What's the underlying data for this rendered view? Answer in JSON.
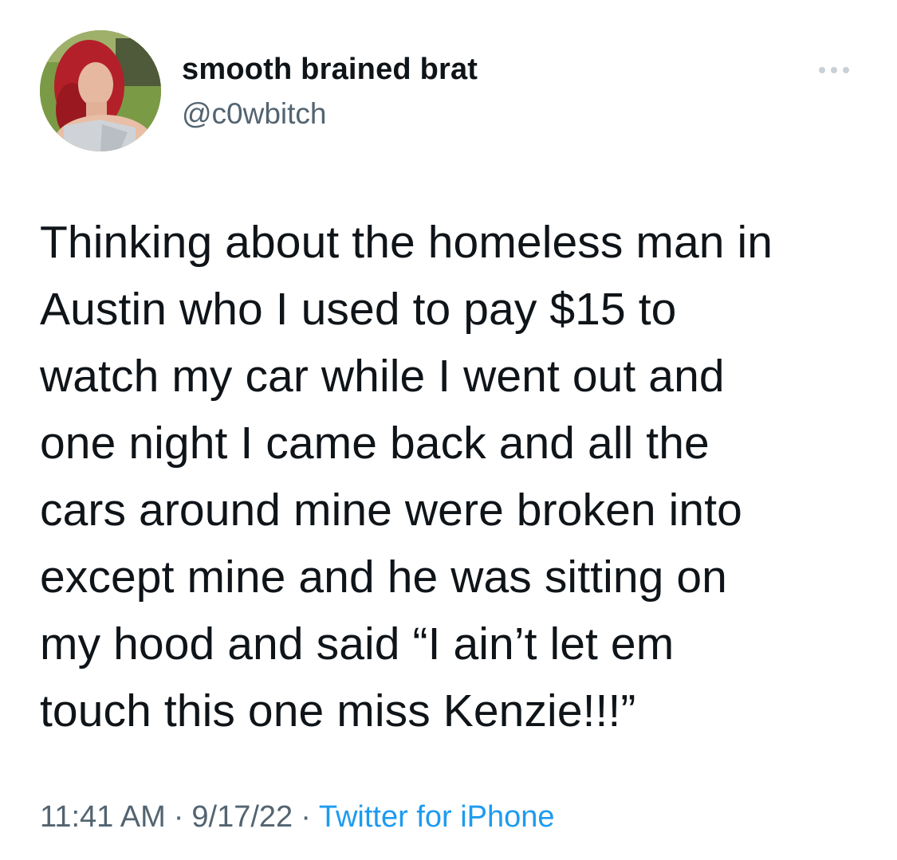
{
  "user": {
    "display_name": "smooth brained brat",
    "handle": "@c0wbitch",
    "avatar_icon": "profile-photo"
  },
  "more_icon": "ellipsis-icon",
  "tweet": {
    "lines": [
      "Thinking about the homeless man in",
      "Austin who I used to pay $15 to",
      "watch my car while I went out and",
      "one night I came back and all the",
      "cars around mine were broken into",
      "except mine and he was sitting on",
      "my hood and said “I ain’t let em",
      "touch this one miss Kenzie!!!”"
    ]
  },
  "meta": {
    "time": "11:41 AM",
    "separator": "·",
    "date": "9/17/22",
    "source": "Twitter for iPhone"
  },
  "colors": {
    "text": "#0f1419",
    "secondary": "#536471",
    "accent": "#1d9bf0"
  }
}
